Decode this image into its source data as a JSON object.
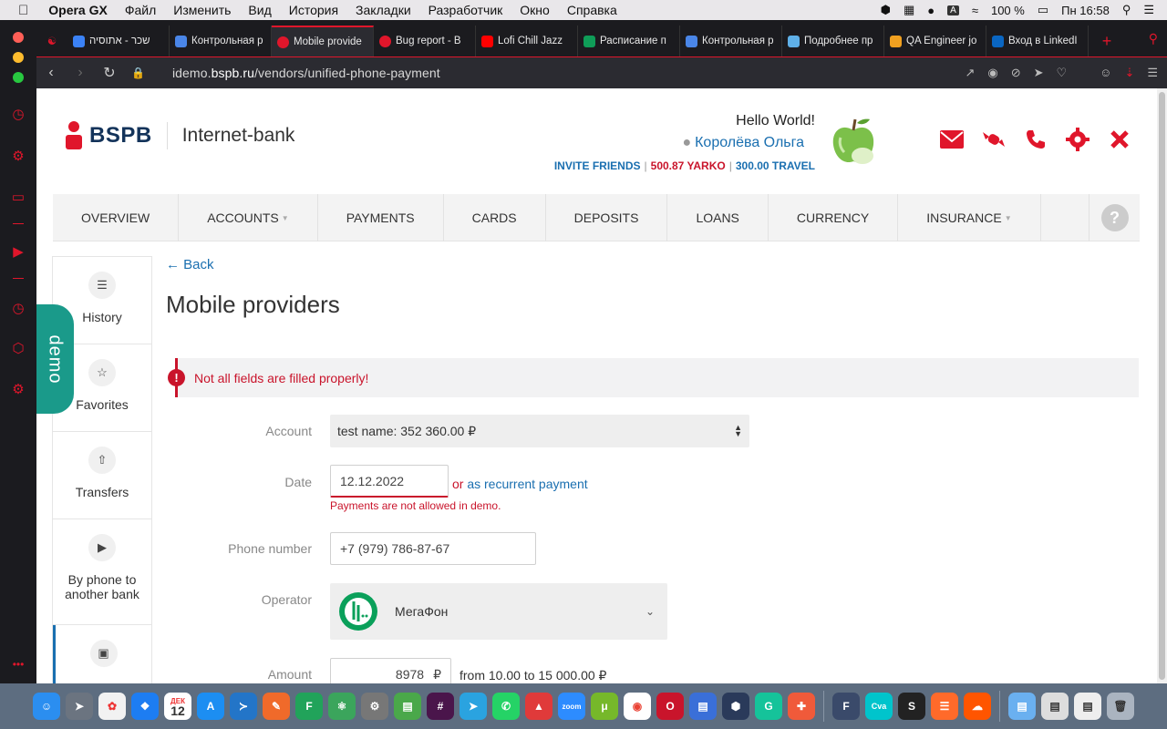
{
  "menubar": {
    "app": "Opera GX",
    "items": [
      "Файл",
      "Изменить",
      "Вид",
      "История",
      "Закладки",
      "Разработчик",
      "Окно",
      "Справка"
    ],
    "battery": "100 %",
    "clock": "Пн 16:58"
  },
  "tabs": [
    {
      "label": "שכר - אתוסיה",
      "color": "#3b82f6"
    },
    {
      "label": "Контрольная р",
      "color": "#4a86e8"
    },
    {
      "label": "Mobile provide",
      "color": "#e0162b",
      "active": true
    },
    {
      "label": "Bug report - B",
      "color": "#e0162b"
    },
    {
      "label": "Lofi Chill Jazz",
      "color": "#ff0000"
    },
    {
      "label": "Расписание п",
      "color": "#0f9d58"
    },
    {
      "label": "Контрольная р",
      "color": "#4a86e8"
    },
    {
      "label": "Подробнее пр",
      "color": "#5fb0e8"
    },
    {
      "label": "QA Engineer jo",
      "color": "#f0a020"
    },
    {
      "label": "Вход в LinkedI",
      "color": "#0a66c2"
    }
  ],
  "address": {
    "prefix": "idemo.",
    "domain": "bspb.ru",
    "path": "/vendors/unified-phone-payment"
  },
  "header": {
    "logo_text": "BSPB",
    "product": "Internet-bank",
    "greeting": "Hello World!",
    "user_name": "Королёва Ольга",
    "invite": "INVITE FRIENDS",
    "yarko": "500.87 YARKO",
    "travel": "300.00 TRAVEL"
  },
  "nav": [
    {
      "label": "OVERVIEW",
      "caret": false
    },
    {
      "label": "ACCOUNTS",
      "caret": true
    },
    {
      "label": "PAYMENTS",
      "caret": false
    },
    {
      "label": "CARDS",
      "caret": false
    },
    {
      "label": "DEPOSITS",
      "caret": false
    },
    {
      "label": "LOANS",
      "caret": false
    },
    {
      "label": "CURRENCY",
      "caret": false
    },
    {
      "label": "INSURANCE",
      "caret": true
    }
  ],
  "help_label": "?",
  "sidenav": [
    {
      "label": "History"
    },
    {
      "label": "Favorites"
    },
    {
      "label": "Transfers"
    },
    {
      "label": "By phone to another bank"
    }
  ],
  "demo_label": "demo",
  "back_label": "Back",
  "page_title": "Mobile providers",
  "alert_text": "Not all fields are filled properly!",
  "form": {
    "account_label": "Account",
    "account_value": "test name: 352 360.00 ₽",
    "date_label": "Date",
    "date_value": "12.12.2022",
    "or_text": "or",
    "recurrent_link": "as recurrent payment",
    "date_error": "Payments are not allowed in demo.",
    "phone_label": "Phone number",
    "phone_value": "+7 (979) 786-87-67",
    "operator_label": "Operator",
    "operator_value": "МегаФон",
    "amount_label": "Amount",
    "amount_value": "8978",
    "currency": "₽",
    "amount_range": "from 10.00 to 15 000.00 ₽"
  },
  "dock_calendar": {
    "month": "ДЕК",
    "day": "12"
  }
}
